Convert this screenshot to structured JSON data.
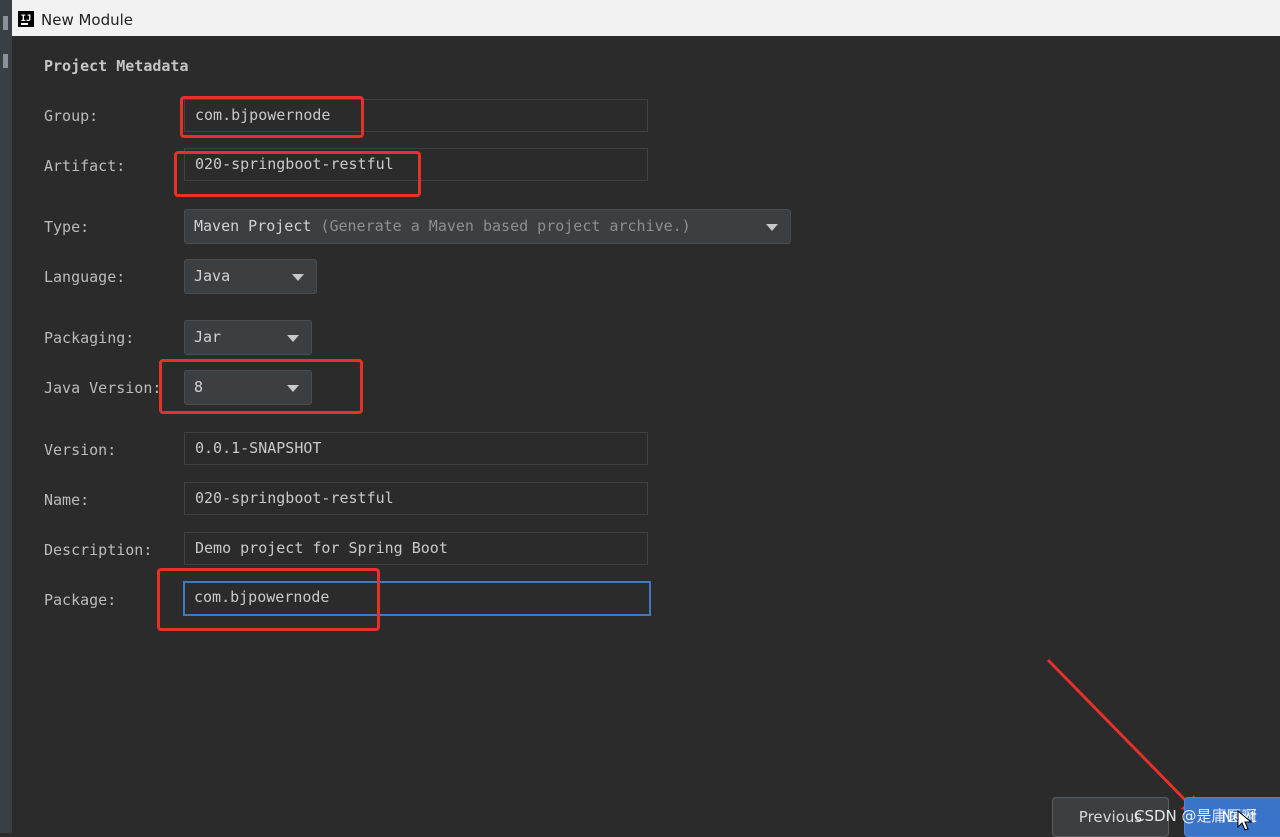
{
  "window": {
    "title": "New Module"
  },
  "section_title": "Project Metadata",
  "fields": {
    "group": {
      "label": "Group:",
      "value": "com.bjpowernode"
    },
    "artifact": {
      "label": "Artifact:",
      "value": "020-springboot-restful"
    },
    "type": {
      "label": "Type:",
      "value": "Maven Project",
      "hint": "(Generate a Maven based project archive.)"
    },
    "language": {
      "label": "Language:",
      "value": "Java"
    },
    "packaging": {
      "label": "Packaging:",
      "value": "Jar"
    },
    "java_version": {
      "label": "Java Version:",
      "value": "8"
    },
    "version": {
      "label": "Version:",
      "value": "0.0.1-SNAPSHOT"
    },
    "name": {
      "label": "Name:",
      "value": "020-springboot-restful"
    },
    "description": {
      "label": "Description:",
      "value": "Demo project for Spring Boot"
    },
    "package": {
      "label": "Package:",
      "value": "com.bjpowernode"
    }
  },
  "buttons": {
    "previous": "Previous",
    "next": "Next"
  },
  "watermark": "CSDN @是庸医啊",
  "colors": {
    "annotation": "#e8302a",
    "accent": "#3a74c9",
    "focus": "#3d7ac2",
    "background": "#2b2b2b"
  }
}
